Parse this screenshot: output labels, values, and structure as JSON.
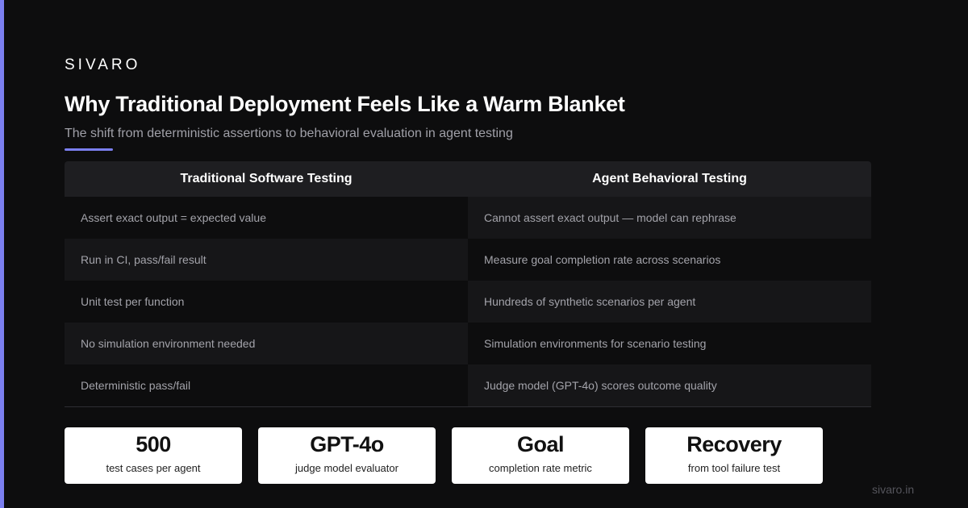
{
  "brand": "SIVARO",
  "title": "Why Traditional Deployment Feels Like a Warm Blanket",
  "subtitle": "The shift from deterministic assertions to behavioral evaluation in agent testing",
  "accent_color": "#7b7ff0",
  "table": {
    "headers": [
      "Traditional Software Testing",
      "Agent Behavioral Testing"
    ],
    "rows": [
      [
        "Assert exact output = expected value",
        "Cannot assert exact output — model can rephrase"
      ],
      [
        "Run in CI, pass/fail result",
        "Measure goal completion rate across scenarios"
      ],
      [
        "Unit test per function",
        "Hundreds of synthetic scenarios per agent"
      ],
      [
        "No simulation environment needed",
        "Simulation environments for scenario testing"
      ],
      [
        "Deterministic pass/fail",
        "Judge model (GPT-4o) scores outcome quality"
      ]
    ]
  },
  "stats": [
    {
      "value": "500",
      "label": "test cases per agent"
    },
    {
      "value": "GPT-4o",
      "label": "judge model evaluator"
    },
    {
      "value": "Goal",
      "label": "completion rate metric"
    },
    {
      "value": "Recovery",
      "label": "from tool failure test"
    }
  ],
  "footer": "sivaro.in"
}
